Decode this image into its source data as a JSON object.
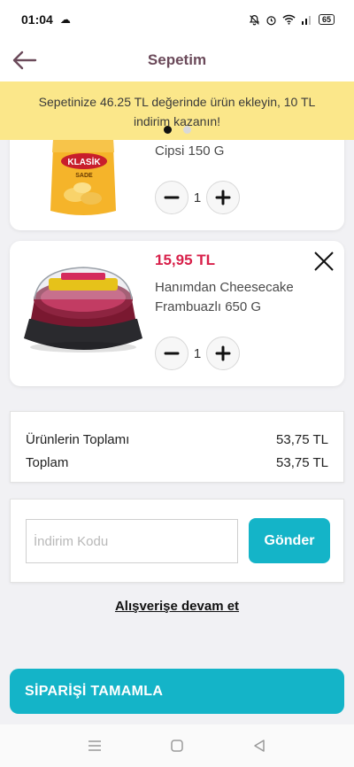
{
  "status_bar": {
    "time": "01:04",
    "battery": "65"
  },
  "header": {
    "title": "Sepetim"
  },
  "banner": {
    "text": "Sepetinize 46.25 TL değerinde ürün ekleyin, 10 TL indirim kazanın!"
  },
  "cart": {
    "items": [
      {
        "name": "Cipsi 150 G",
        "quantity": "1",
        "image_label": "KLASİK",
        "image_sub": "SADE"
      },
      {
        "name": "Hanımdan Cheesecake Frambuazlı 650 G",
        "price": "15,95 TL",
        "quantity": "1"
      }
    ]
  },
  "totals": {
    "subtotal_label": "Ürünlerin Toplamı",
    "subtotal_value": "53,75 TL",
    "total_label": "Toplam",
    "total_value": "53,75 TL"
  },
  "coupon": {
    "placeholder": "İndirim Kodu",
    "value": "",
    "button_label": "Gönder"
  },
  "continue_label": "Alışverişe devam et",
  "complete_label": "SİPARİŞİ TAMAMLA",
  "colors": {
    "accent": "#14b4c8",
    "price": "#d8204a",
    "banner": "#fbe78a",
    "title": "#6b4a5a"
  }
}
